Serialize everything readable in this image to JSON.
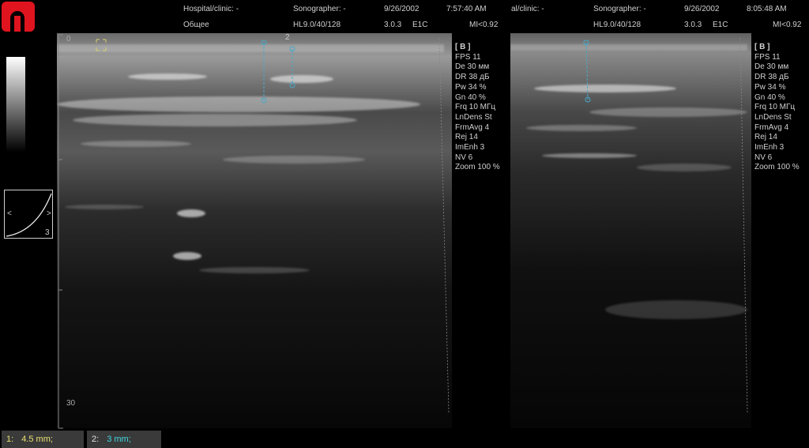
{
  "left_header": {
    "clinic": "Hospital/clinic: -",
    "sonographer": "Sonographer: -",
    "date": "9/26/2002",
    "time": "7:57:40 AM",
    "preset": "Общее",
    "probe": "HL9.0/40/128",
    "version": "3.0.3",
    "code": "E1C",
    "mi": "MI<0.92"
  },
  "right_header": {
    "clinic": "al/clinic: -",
    "sonographer": "Sonographer: -",
    "date": "9/26/2002",
    "time": "8:05:48 AM",
    "probe": "HL9.0/40/128",
    "version": "3.0.3",
    "code": "E1C",
    "mi": "MI<0.92"
  },
  "params": {
    "header": "[ B ]",
    "items": [
      "FPS 11",
      "De 30 мм",
      "DR 38 дБ",
      "Pw 34 %",
      "Gn 40 %",
      "Frq 10 МГц",
      "LnDens St",
      "FrmAvg 4",
      "Rej 14",
      "ImEnh 3",
      "NV 6",
      "Zoom 100 %"
    ]
  },
  "depth": {
    "start": "0",
    "end": "30"
  },
  "curve_label": "3",
  "curve_left": "<",
  "curve_right": ">",
  "marker_label": "2",
  "measurements": [
    {
      "index": "1:",
      "value": "4.5 mm;",
      "color": "#e8e070"
    },
    {
      "index": "2:",
      "value": "3 mm;",
      "color": "#40d8e0"
    }
  ],
  "colors": {
    "caliper": "#4aa8c8",
    "logo": "#e0141e"
  }
}
